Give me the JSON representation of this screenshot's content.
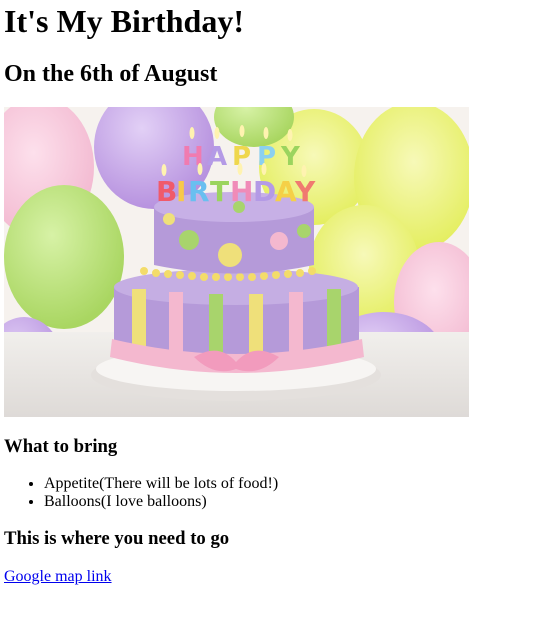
{
  "heading": {
    "title": "It's My Birthday!",
    "subtitle": "On the 6th of August"
  },
  "image": {
    "alt": "Birthday cake with HAPPY BIRTHDAY candles",
    "candles_top": [
      "H",
      "A",
      "P",
      "P",
      "Y"
    ],
    "candles_bottom": [
      "B",
      "I",
      "R",
      "T",
      "H",
      "D",
      "A",
      "Y"
    ],
    "colors": {
      "bg_yellow": "#e9f06a",
      "bg_purple": "#c7a8e6",
      "bg_pink": "#f3c3d6",
      "bg_green": "#bfe38a",
      "cake_purple": "#b59ad9",
      "cake_yellow": "#efe07a",
      "cake_pink": "#f4b8cf",
      "cake_green": "#a8d46c",
      "plate": "#f4f1ee"
    }
  },
  "bring": {
    "title": "What to bring",
    "items": [
      "Appetite(There will be lots of food!)",
      "Balloons(I love balloons)"
    ]
  },
  "directions": {
    "title": "This is where you need to go",
    "link_label": "Google map link"
  }
}
